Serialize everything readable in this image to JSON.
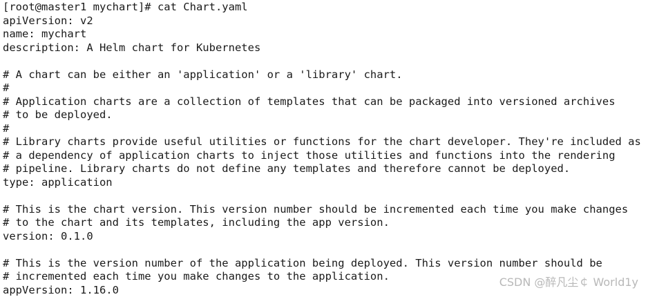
{
  "terminal": {
    "lines": [
      "[root@master1 mychart]# cat Chart.yaml",
      "apiVersion: v2",
      "name: mychart",
      "description: A Helm chart for Kubernetes",
      "",
      "# A chart can be either an 'application' or a 'library' chart.",
      "#",
      "# Application charts are a collection of templates that can be packaged into versioned archives",
      "# to be deployed.",
      "#",
      "# Library charts provide useful utilities or functions for the chart developer. They're included as",
      "# a dependency of application charts to inject those utilities and functions into the rendering",
      "# pipeline. Library charts do not define any templates and therefore cannot be deployed.",
      "type: application",
      "",
      "# This is the chart version. This version number should be incremented each time you make changes",
      "# to the chart and its templates, including the app version.",
      "version: 0.1.0",
      "",
      "# This is the version number of the application being deployed. This version number should be",
      "# incremented each time you make changes to the application.",
      "appVersion: 1.16.0"
    ]
  },
  "watermark": {
    "text": "CSDN @醉凡尘￠ World1y"
  }
}
